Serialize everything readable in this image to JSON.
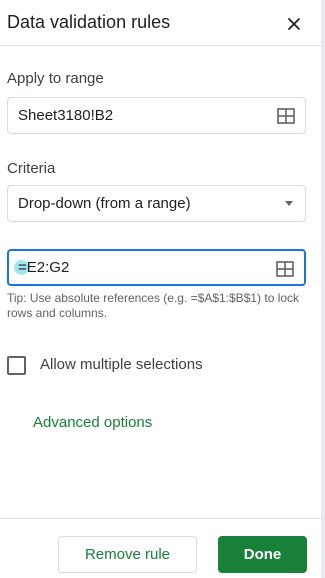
{
  "panel": {
    "title": "Data validation rules",
    "close_icon": "close-icon"
  },
  "range": {
    "label": "Apply to range",
    "value": "Sheet3180!B2",
    "icon": "grid-icon"
  },
  "criteria": {
    "label": "Criteria",
    "selected": "Drop-down (from a range)",
    "icon": "chevron-down-icon",
    "range_value": "=E2:G2",
    "range_icon": "grid-icon",
    "tip": "Tip: Use absolute references (e.g. =$A$1:$B$1) to lock rows and columns."
  },
  "options": {
    "allow_multiple_label": "Allow multiple selections",
    "allow_multiple_checked": false,
    "advanced_label": "Advanced options"
  },
  "footer": {
    "remove_label": "Remove rule",
    "done_label": "Done"
  },
  "colors": {
    "accent_green": "#188038",
    "focus_blue": "#1a73e8"
  }
}
